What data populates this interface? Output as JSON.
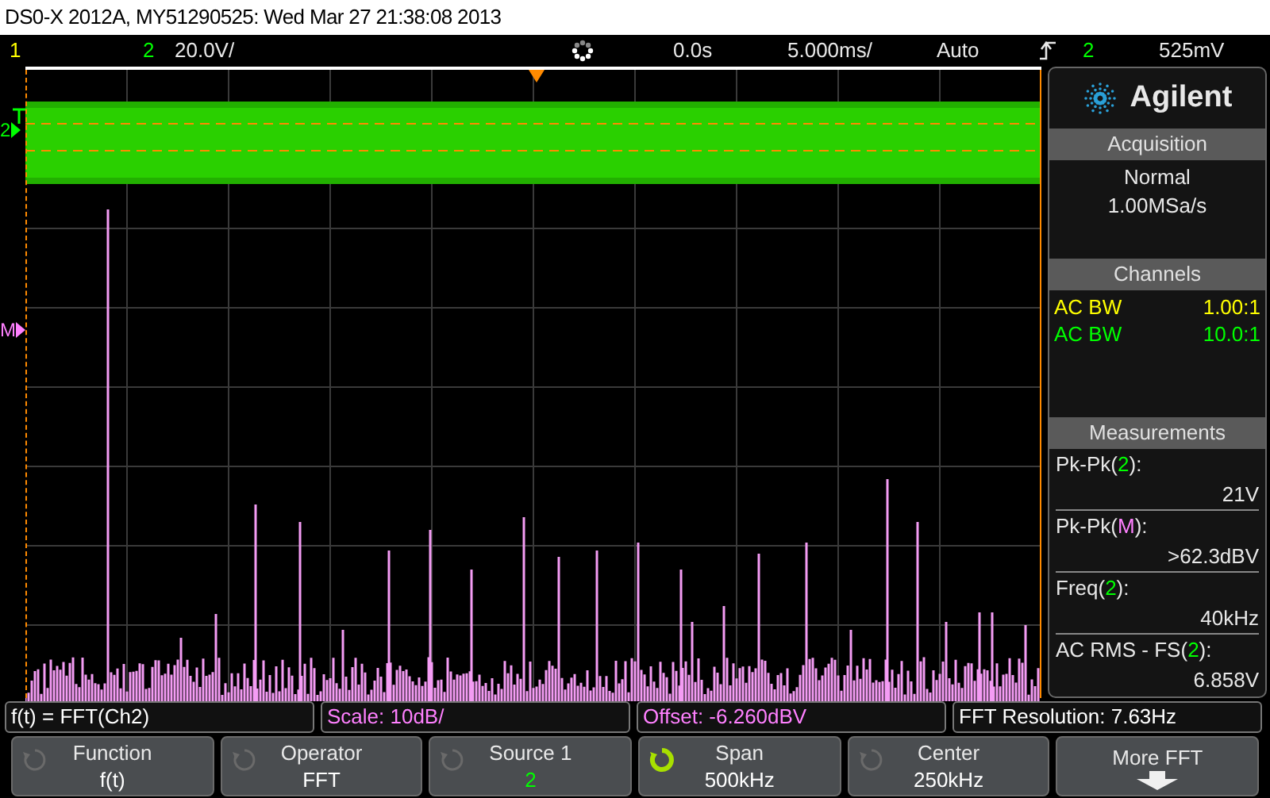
{
  "title": "DS0-X 2012A, MY51290525: Wed Mar 27 21:38:08 2013",
  "status_bar": {
    "channel_1": {
      "label": "1",
      "color": "#ffff00"
    },
    "channel_2": {
      "label": "2",
      "color": "#00ff00"
    },
    "channel_2_scale": "20.0V/",
    "delay": "0.0s",
    "timebase": "5.000ms/",
    "trigger_mode": "Auto",
    "trigger_source": {
      "label": "2",
      "color": "#00ff00"
    },
    "trigger_level": "525mV"
  },
  "markers": [
    {
      "label": "2",
      "color": "#00ff00"
    },
    {
      "label": "M",
      "color": "#ff80ff"
    }
  ],
  "side_panel": {
    "logo": "Agilent",
    "acquisition": {
      "title": "Acquisition",
      "mode": "Normal",
      "rate": "1.00MSa/s"
    },
    "channels": {
      "title": "Channels",
      "items": [
        {
          "coupling": "AC BW",
          "probe": "1.00:1",
          "color": "#ffff00"
        },
        {
          "coupling": "AC BW",
          "probe": "10.0:1",
          "color": "#00ff00"
        }
      ]
    },
    "measurements": {
      "title": "Measurements",
      "items": [
        {
          "label_start": "Pk-Pk(",
          "source": "2",
          "label_end": "):",
          "value": "21V",
          "color": "#00ff00"
        },
        {
          "label_start": "Pk-Pk(",
          "source": "M",
          "label_end": "):",
          "value": ">62.3dBV",
          "color": "#ff80ff"
        },
        {
          "label_start": "Freq(",
          "source": "2",
          "label_end": "):",
          "value": "40kHz",
          "color": "#00ff00"
        },
        {
          "label_start": "AC RMS - FS(",
          "source": "2",
          "label_end": "):",
          "value": "6.858V",
          "color": "#00ff00"
        }
      ]
    }
  },
  "info_row": [
    {
      "text": "f(t) = FFT(Ch2)",
      "color": "#ffffff"
    },
    {
      "text": "Scale: 10dB/",
      "color": "#ff80ff"
    },
    {
      "text": "Offset: -6.260dBV",
      "color": "#ff80ff"
    },
    {
      "text": "FFT Resolution: 7.63Hz",
      "color": "#ffffff"
    }
  ],
  "softkeys": [
    {
      "kind": "value",
      "label": "Function",
      "value": "f(t)",
      "knob_active": false,
      "color": "#ffffff"
    },
    {
      "kind": "value",
      "label": "Operator",
      "value": "FFT",
      "knob_active": false,
      "color": "#ffffff"
    },
    {
      "kind": "value",
      "label": "Source 1",
      "value": "2",
      "knob_active": false,
      "color": "#00ff00"
    },
    {
      "kind": "value",
      "label": "Span",
      "value": "500kHz",
      "knob_active": true,
      "color": "#ffffff"
    },
    {
      "kind": "value",
      "label": "Center",
      "value": "250kHz",
      "knob_active": false,
      "color": "#ffffff"
    },
    {
      "kind": "menu",
      "label": "More FFT"
    }
  ]
}
